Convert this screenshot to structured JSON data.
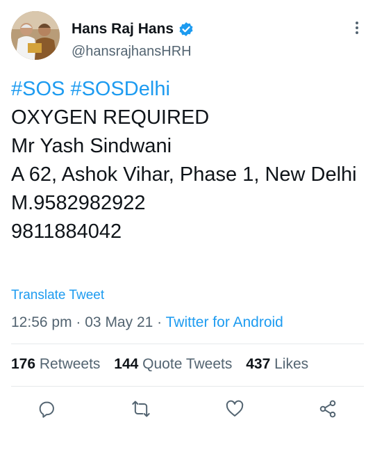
{
  "tweet": {
    "author": {
      "display_name": "Hans Raj Hans",
      "handle": "@hansrajhansHRH",
      "verified": true
    },
    "text": {
      "hashtag1": "#SOS",
      "hashtag2": "#SOSDelhi",
      "line2": "OXYGEN REQUIRED",
      "line3": "Mr Yash Sindwani",
      "line4": "A 62, Ashok Vihar, Phase 1, New Delhi",
      "line5": "M.9582982922",
      "line6": "9811884042"
    },
    "translate_label": "Translate Tweet",
    "time": "12:56 pm",
    "date": "03 May 21",
    "separator": "·",
    "source": "Twitter for Android",
    "stats": {
      "retweets_count": "176",
      "retweets_label": "Retweets",
      "quotes_count": "144",
      "quotes_label": "Quote Tweets",
      "likes_count": "437",
      "likes_label": "Likes"
    }
  },
  "icons": {
    "verified": "verified-badge-icon",
    "more": "more-options-icon",
    "reply": "reply-icon",
    "retweet": "retweet-icon",
    "like": "heart-icon",
    "share": "share-icon"
  },
  "colors": {
    "accent": "#1d9bf0",
    "secondary_text": "#536471",
    "primary_text": "#0f1419"
  }
}
